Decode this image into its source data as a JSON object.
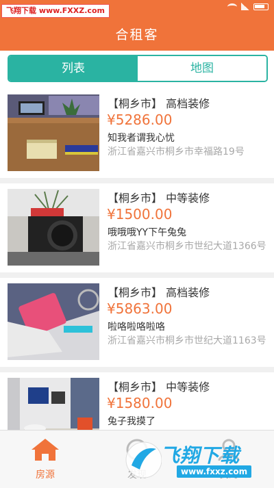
{
  "watermark_top": "飞翔下载 www.FXXZ.com",
  "app_title": "合租客",
  "tabs": [
    {
      "label": "列表",
      "active": true
    },
    {
      "label": "地图",
      "active": false
    }
  ],
  "listings": [
    {
      "city": "【桐乡市】",
      "decor": "高档装修",
      "price": "¥5286.00",
      "title": "知我者谓我心忧",
      "address": "浙江省嘉兴市桐乡市幸福路19号"
    },
    {
      "city": "【桐乡市】",
      "decor": "中等装修",
      "price": "¥1500.00",
      "title": "哦哦哦YY下午兔兔",
      "address": "浙江省嘉兴市桐乡市世纪大道1366号"
    },
    {
      "city": "【桐乡市】",
      "decor": "高档装修",
      "price": "¥5863.00",
      "title": "啦咯啦咯啦咯",
      "address": "浙江省嘉兴市桐乡市世纪大道1163号"
    },
    {
      "city": "【桐乡市】",
      "decor": "中等装修",
      "price": "¥1580.00",
      "title": "兔子我摸了",
      "address": ""
    }
  ],
  "bottom_nav": [
    {
      "label": "房源",
      "icon": "house-icon",
      "active": true
    },
    {
      "label": "发现",
      "icon": "discover-icon",
      "active": false
    },
    {
      "label": "我的",
      "icon": "profile-icon",
      "active": false
    }
  ],
  "watermark_logo": {
    "text": "飞翔下载",
    "url": "www.fxxz.com"
  },
  "colors": {
    "brand": "#f0733a",
    "accent": "#2ab3a2"
  }
}
